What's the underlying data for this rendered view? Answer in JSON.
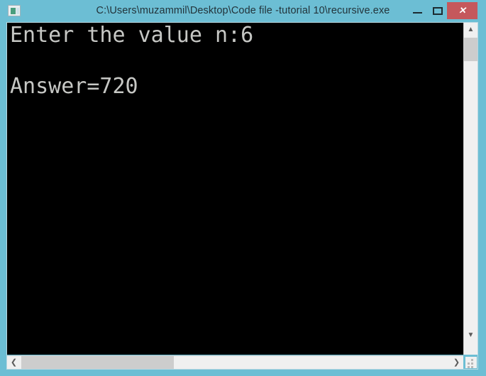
{
  "window": {
    "title": "C:\\Users\\muzammil\\Desktop\\Code file -tutorial 10\\recursive.exe",
    "frame_color": "#6cbed4",
    "icon_name": "console-app-icon",
    "controls": {
      "minimize_label": "–",
      "maximize_label": "",
      "close_label": "✕"
    }
  },
  "console": {
    "background_color": "#000000",
    "text_color": "#c6c7c4",
    "lines": [
      "Enter the value n:6",
      "",
      "Answer=720"
    ],
    "content": "Enter the value n:6\n\nAnswer=720",
    "prompt_text": "Enter the value n:",
    "input_value": "6",
    "result_label": "Answer=",
    "result_value": "720"
  },
  "scrollbars": {
    "vertical": {
      "up_arrow": "▲",
      "down_arrow": "▼",
      "thumb_color": "#cdcdcd"
    },
    "horizontal": {
      "left_arrow": "❮",
      "right_arrow": "❯",
      "thumb_color": "#cdcdcd"
    }
  }
}
